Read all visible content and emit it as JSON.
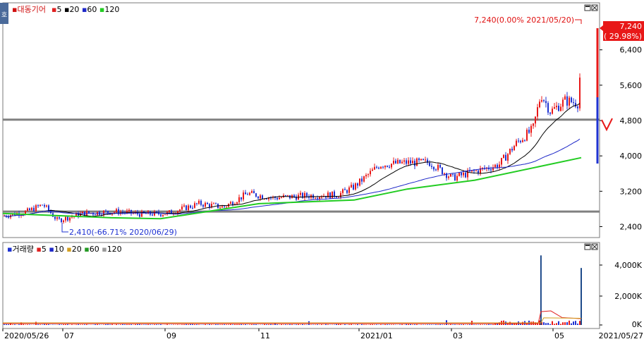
{
  "side_tab": "호",
  "price_panel": {
    "legend": {
      "stock_name": "대동기어",
      "ma": [
        {
          "label": "5",
          "color": "#e02020"
        },
        {
          "label": "20",
          "color": "#000000"
        },
        {
          "label": "60",
          "color": "#1e28c8"
        },
        {
          "label": "120",
          "color": "#22cc22"
        }
      ]
    },
    "y_ticks": [
      "6,400",
      "5,600",
      "4,800",
      "4,000",
      "3,200",
      "2,400"
    ],
    "current_price": "7,240",
    "current_change": "( 29.98%)",
    "high_annotation": "7,240(0.00% 2021/05/20)",
    "low_annotation": "2,410(-66.71% 2020/06/29)",
    "up_color": "#e81818",
    "down_color": "#1e32d2"
  },
  "volume_panel": {
    "legend": {
      "title": "거래량",
      "ma": [
        {
          "label": "5",
          "color": "#e02020"
        },
        {
          "label": "10",
          "color": "#1e28c8"
        },
        {
          "label": "20",
          "color": "#d4a020"
        },
        {
          "label": "60",
          "color": "#229922"
        },
        {
          "label": "120",
          "color": "#999999"
        }
      ]
    },
    "y_ticks": [
      "4,000K",
      "2,000K",
      "0K"
    ]
  },
  "x_axis": {
    "labels": [
      "2020/05/26",
      "07",
      "09",
      "11",
      "2021/01",
      "03",
      "05"
    ],
    "end_label": "2021/05/27"
  },
  "chart_data": {
    "type": "candlestick",
    "x_range": [
      "2020/05/26",
      "2021/05/27"
    ],
    "y_range": [
      2200,
      7400
    ],
    "y_ticks": [
      2400,
      3200,
      4000,
      4800,
      5600,
      6400
    ],
    "grid": false,
    "legend_position": "top-left",
    "last_close": 7240,
    "last_change_pct": 29.98,
    "high_point": {
      "date": "2021/05/20",
      "value": 7240
    },
    "low_point": {
      "date": "2020/06/29",
      "value": 2410
    },
    "horizontal_lines": [
      4820,
      2740
    ],
    "close_series": [
      {
        "x": "2020/05/26",
        "y": 2640
      },
      {
        "x": "2020/06/10",
        "y": 2740
      },
      {
        "x": "2020/06/20",
        "y": 2900
      },
      {
        "x": "2020/06/29",
        "y": 2540
      },
      {
        "x": "2020/07/15",
        "y": 2700
      },
      {
        "x": "2020/08/05",
        "y": 2740
      },
      {
        "x": "2020/08/20",
        "y": 2680
      },
      {
        "x": "2020/09/05",
        "y": 2700
      },
      {
        "x": "2020/09/25",
        "y": 2920
      },
      {
        "x": "2020/10/10",
        "y": 2840
      },
      {
        "x": "2020/10/25",
        "y": 3150
      },
      {
        "x": "2020/11/10",
        "y": 3050
      },
      {
        "x": "2020/12/01",
        "y": 3100
      },
      {
        "x": "2020/12/20",
        "y": 3120
      },
      {
        "x": "2020/12/30",
        "y": 3300
      },
      {
        "x": "2021/01/15",
        "y": 3800
      },
      {
        "x": "2021/02/01",
        "y": 3850
      },
      {
        "x": "2021/02/15",
        "y": 3850
      },
      {
        "x": "2021/03/01",
        "y": 3500
      },
      {
        "x": "2021/03/15",
        "y": 3650
      },
      {
        "x": "2021/03/30",
        "y": 3800
      },
      {
        "x": "2021/04/10",
        "y": 4300
      },
      {
        "x": "2021/04/20",
        "y": 4600
      },
      {
        "x": "2021/04/25",
        "y": 5400
      },
      {
        "x": "2021/05/01",
        "y": 5000
      },
      {
        "x": "2021/05/10",
        "y": 5250
      },
      {
        "x": "2021/05/18",
        "y": 5200
      },
      {
        "x": "2021/05/19",
        "y": 5570
      },
      {
        "x": "2021/05/20",
        "y": 7240
      }
    ],
    "ma120_series": [
      {
        "x": "2020/05/26",
        "y": 2700
      },
      {
        "x": "2020/08/01",
        "y": 2600
      },
      {
        "x": "2020/09/01",
        "y": 2580
      },
      {
        "x": "2020/11/01",
        "y": 2920
      },
      {
        "x": "2020/12/30",
        "y": 3000
      },
      {
        "x": "2021/02/01",
        "y": 3250
      },
      {
        "x": "2021/03/15",
        "y": 3450
      },
      {
        "x": "2021/05/20",
        "y": 3960
      }
    ],
    "volume_peaks": [
      {
        "x": "2021/04/25",
        "y": 4700
      },
      {
        "x": "2021/05/20",
        "y": 3850
      }
    ]
  }
}
